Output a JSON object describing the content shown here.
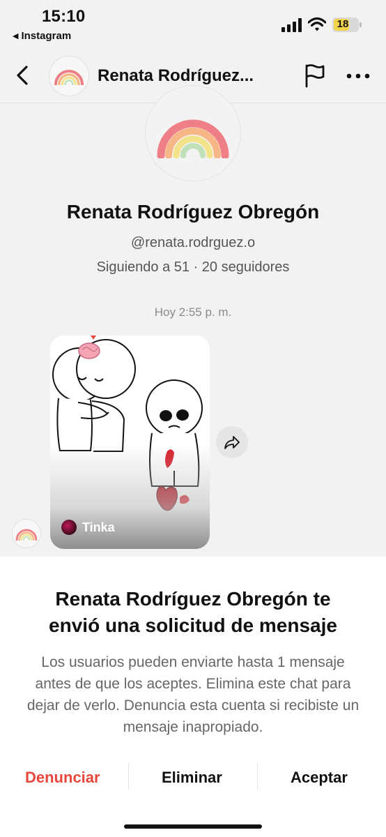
{
  "status_bar": {
    "time": "15:10",
    "back_app": "Instagram",
    "battery": "18",
    "icons": [
      "signal-icon",
      "wifi-icon",
      "battery-icon"
    ]
  },
  "header": {
    "name": "Renata Rodríguez...",
    "icons": [
      "back-icon",
      "flag-icon",
      "more-icon"
    ]
  },
  "profile": {
    "name": "Renata Rodríguez Obregón",
    "handle": "@renata.rodrguez.o",
    "stats": "Siguiendo a 51 · 20 seguidores"
  },
  "conversation": {
    "timestamp": "Hoy 2:55 p. m.",
    "shared_post_user": "Tinka",
    "icons": [
      "share-icon"
    ]
  },
  "request_sheet": {
    "title": "Renata Rodríguez Obregón te envió una solicitud de mensaje",
    "body": "Los usuarios pueden enviarte hasta 1 mensaje antes de que los aceptes. Elimina este chat para dejar de verlo. Denuncia esta cuenta si recibiste un mensaje inapropiado.",
    "report_label": "Denunciar",
    "delete_label": "Eliminar",
    "accept_label": "Aceptar"
  },
  "colors": {
    "report": "#e8453c",
    "battery_fill": "#f2d44a"
  }
}
